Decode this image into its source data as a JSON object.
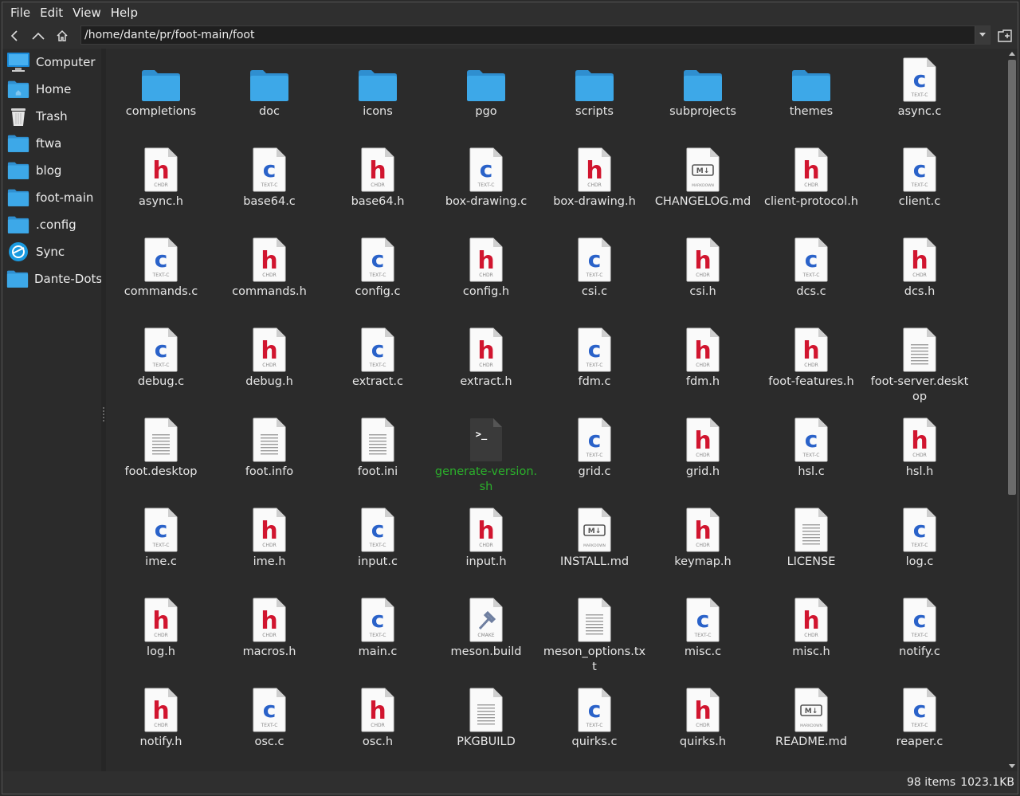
{
  "menubar": {
    "items": [
      "File",
      "Edit",
      "View",
      "Help"
    ]
  },
  "toolbar": {
    "path": "/home/dante/pr/foot-main/foot"
  },
  "sidebar": {
    "items": [
      {
        "label": "Computer",
        "icon": "computer-icon"
      },
      {
        "label": "Home",
        "icon": "home-folder-icon"
      },
      {
        "label": "Trash",
        "icon": "trash-icon"
      },
      {
        "label": "ftwa",
        "icon": "folder-icon"
      },
      {
        "label": "blog",
        "icon": "folder-icon"
      },
      {
        "label": "foot-main",
        "icon": "folder-icon"
      },
      {
        "label": ".config",
        "icon": "folder-icon"
      },
      {
        "label": "Sync",
        "icon": "sync-icon"
      },
      {
        "label": "Dante-Dots",
        "icon": "folder-icon"
      }
    ]
  },
  "files": [
    {
      "name": "completions",
      "type": "folder"
    },
    {
      "name": "doc",
      "type": "folder"
    },
    {
      "name": "icons",
      "type": "folder"
    },
    {
      "name": "pgo",
      "type": "folder"
    },
    {
      "name": "scripts",
      "type": "folder"
    },
    {
      "name": "subprojects",
      "type": "folder"
    },
    {
      "name": "themes",
      "type": "folder"
    },
    {
      "name": "async.c",
      "type": "c"
    },
    {
      "name": "async.h",
      "type": "h"
    },
    {
      "name": "base64.c",
      "type": "c"
    },
    {
      "name": "base64.h",
      "type": "h"
    },
    {
      "name": "box-drawing.c",
      "type": "c"
    },
    {
      "name": "box-drawing.h",
      "type": "h"
    },
    {
      "name": "CHANGELOG.md",
      "type": "md"
    },
    {
      "name": "client-protocol.h",
      "type": "h"
    },
    {
      "name": "client.c",
      "type": "c"
    },
    {
      "name": "commands.c",
      "type": "c"
    },
    {
      "name": "commands.h",
      "type": "h"
    },
    {
      "name": "config.c",
      "type": "c"
    },
    {
      "name": "config.h",
      "type": "h"
    },
    {
      "name": "csi.c",
      "type": "c"
    },
    {
      "name": "csi.h",
      "type": "h"
    },
    {
      "name": "dcs.c",
      "type": "c"
    },
    {
      "name": "dcs.h",
      "type": "h"
    },
    {
      "name": "debug.c",
      "type": "c"
    },
    {
      "name": "debug.h",
      "type": "h"
    },
    {
      "name": "extract.c",
      "type": "c"
    },
    {
      "name": "extract.h",
      "type": "h"
    },
    {
      "name": "fdm.c",
      "type": "c"
    },
    {
      "name": "fdm.h",
      "type": "h"
    },
    {
      "name": "foot-features.h",
      "type": "h"
    },
    {
      "name": "foot-server.desktop",
      "type": "text"
    },
    {
      "name": "foot.desktop",
      "type": "text"
    },
    {
      "name": "foot.info",
      "type": "text"
    },
    {
      "name": "foot.ini",
      "type": "text"
    },
    {
      "name": "generate-version.sh",
      "type": "sh"
    },
    {
      "name": "grid.c",
      "type": "c"
    },
    {
      "name": "grid.h",
      "type": "h"
    },
    {
      "name": "hsl.c",
      "type": "c"
    },
    {
      "name": "hsl.h",
      "type": "h"
    },
    {
      "name": "ime.c",
      "type": "c"
    },
    {
      "name": "ime.h",
      "type": "h"
    },
    {
      "name": "input.c",
      "type": "c"
    },
    {
      "name": "input.h",
      "type": "h"
    },
    {
      "name": "INSTALL.md",
      "type": "md"
    },
    {
      "name": "keymap.h",
      "type": "h"
    },
    {
      "name": "LICENSE",
      "type": "text"
    },
    {
      "name": "log.c",
      "type": "c"
    },
    {
      "name": "log.h",
      "type": "h"
    },
    {
      "name": "macros.h",
      "type": "h"
    },
    {
      "name": "main.c",
      "type": "c"
    },
    {
      "name": "meson.build",
      "type": "cmake"
    },
    {
      "name": "meson_options.txt",
      "type": "text"
    },
    {
      "name": "misc.c",
      "type": "c"
    },
    {
      "name": "misc.h",
      "type": "h"
    },
    {
      "name": "notify.c",
      "type": "c"
    },
    {
      "name": "notify.h",
      "type": "h"
    },
    {
      "name": "osc.c",
      "type": "c"
    },
    {
      "name": "osc.h",
      "type": "h"
    },
    {
      "name": "PKGBUILD",
      "type": "text"
    },
    {
      "name": "quirks.c",
      "type": "c"
    },
    {
      "name": "quirks.h",
      "type": "h"
    },
    {
      "name": "README.md",
      "type": "md"
    },
    {
      "name": "reaper.c",
      "type": "c"
    }
  ],
  "icon_captions": {
    "c": "TEXT-C",
    "h": "CHDR",
    "md": "MARKDOWN",
    "cmake": "CMAKE",
    "md_glyph": "M↓",
    "sh_glyph": ">_"
  },
  "status": {
    "count": "98 items",
    "size": "1023.1KB"
  },
  "colors": {
    "folder": "#3da8e8",
    "c_letter": "#2a62c9",
    "h_letter": "#d1152f",
    "exec_text": "#2bb02b"
  }
}
